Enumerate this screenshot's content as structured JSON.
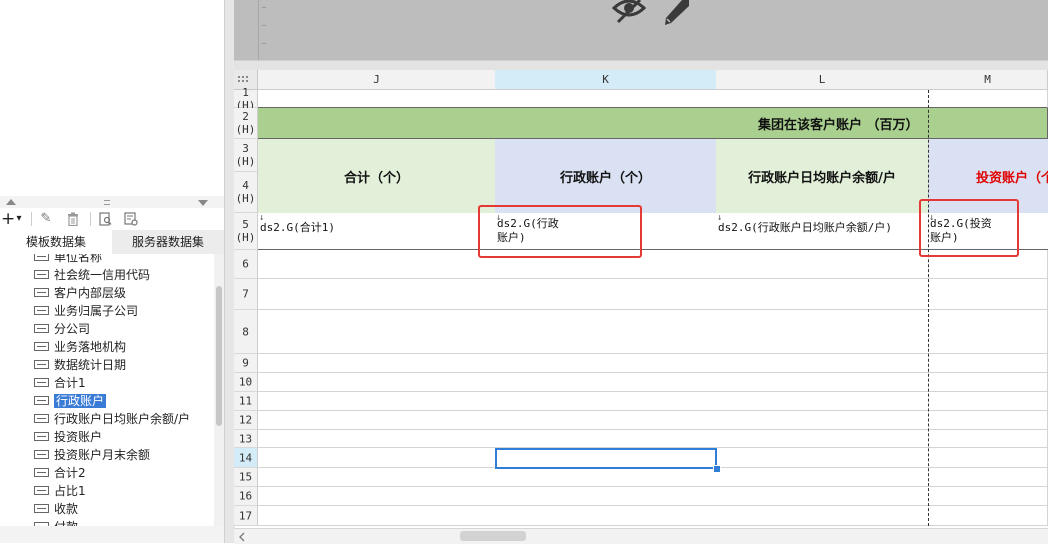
{
  "left_panel": {
    "tabs": [
      "模板数据集",
      "服务器数据集"
    ],
    "toolbar": {
      "add": "+",
      "dropdown": "▾",
      "edit": "✎",
      "delete": "🗑"
    },
    "fields": [
      {
        "label": "单位名称"
      },
      {
        "label": "社会统一信用代码"
      },
      {
        "label": "客户内部层级"
      },
      {
        "label": "业务归属子公司"
      },
      {
        "label": "分公司"
      },
      {
        "label": "业务落地机构"
      },
      {
        "label": "数据统计日期"
      },
      {
        "label": "合计1"
      },
      {
        "label": "行政账户",
        "selected": true
      },
      {
        "label": "行政账户日均账户余额/户"
      },
      {
        "label": "投资账户"
      },
      {
        "label": "投资账户月末余额"
      },
      {
        "label": "合计2"
      },
      {
        "label": "占比1"
      },
      {
        "label": "收款"
      },
      {
        "label": "付款"
      }
    ]
  },
  "grid": {
    "columns": [
      "J",
      "K",
      "L",
      "M"
    ],
    "selected_column": "K",
    "row_labels": [
      "1 (H)",
      "2 (H)",
      "3 (H)",
      "4 (H)",
      "5 (H)",
      "6",
      "7",
      "8",
      "9",
      "10",
      "11",
      "12",
      "13",
      "14",
      "15",
      "16",
      "17"
    ],
    "selected_row": "14",
    "group_header": "集团在该客户账户 （百万）",
    "headers": [
      "合计（个）",
      "行政账户（个）",
      "行政账户日均账户余额/户",
      "投资账户（个"
    ],
    "data_row": [
      "ds2.G(合计1)",
      "ds2.G(行政\n账户)",
      "ds2.G(行政账户日均账户余额/户)",
      "ds2.G(投资\n账户)"
    ]
  },
  "colors": {
    "group_header_bg": "#a9d08e",
    "header_green_bg": "#e2efd9",
    "header_blue_bg": "#d9e1f2",
    "highlight_text": "#e00000",
    "annotation_red": "#e53935",
    "selection_blue": "#2f7ed8"
  }
}
